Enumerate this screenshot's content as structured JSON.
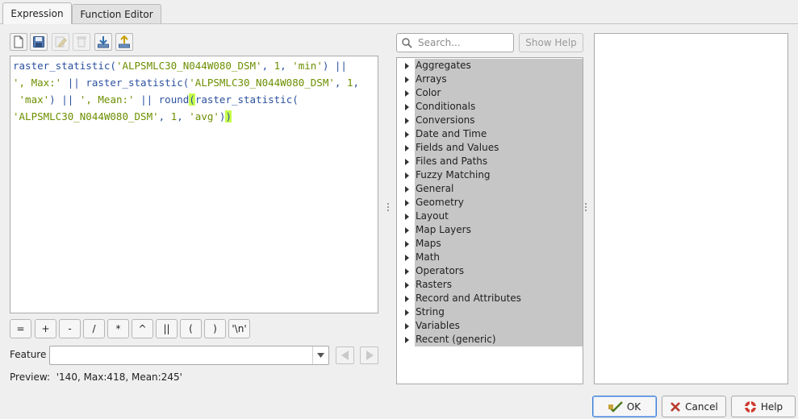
{
  "tabs": [
    {
      "label": "Expression",
      "active": true
    },
    {
      "label": "Function Editor",
      "active": false
    }
  ],
  "toolbar": {
    "icons": [
      "new-file-icon",
      "save-icon",
      "edit-icon",
      "delete-icon",
      "import-icon",
      "export-icon"
    ]
  },
  "editor": {
    "line1": {
      "fn": "raster_statistic(",
      "s1": "'ALPSMLC30_N044W080_DSM'",
      "c1": ", ",
      "n1": "1",
      "c2": ", ",
      "s2": "'min'",
      "op": ") ||"
    },
    "line2": {
      "s1": "', Max:'",
      "op1": " || ",
      "fn": "raster_statistic(",
      "s2": "'ALPSMLC30_N044W080_DSM'",
      "c1": ", ",
      "n1": "1",
      "c2": ","
    },
    "line3": {
      "pre": " ",
      "s1": "'max'",
      "op1": ") || ",
      "s2": "', Mean:'",
      "op2": " || ",
      "fn1": "round",
      "paren": "(",
      "fn2": "raster_statistic("
    },
    "line4": {
      "s1": "'ALPSMLC30_N044W080_DSM'",
      "c1": ", ",
      "n1": "1",
      "c2": ", ",
      "s2": "'avg'",
      "close1": ")",
      "close2": ")"
    }
  },
  "operators": [
    "=",
    "+",
    "-",
    "/",
    "*",
    "^",
    "||",
    "(",
    ")",
    "'\\n'"
  ],
  "feature": {
    "label": "Feature",
    "value": ""
  },
  "preview": {
    "label": "Preview:",
    "value": "'140, Max:418, Mean:245'"
  },
  "search": {
    "placeholder": "Search..."
  },
  "show_help_label": "Show Help",
  "tree": [
    "Aggregates",
    "Arrays",
    "Color",
    "Conditionals",
    "Conversions",
    "Date and Time",
    "Fields and Values",
    "Files and Paths",
    "Fuzzy Matching",
    "General",
    "Geometry",
    "Layout",
    "Map Layers",
    "Maps",
    "Math",
    "Operators",
    "Rasters",
    "Record and Attributes",
    "String",
    "Variables",
    "Recent (generic)"
  ],
  "buttons": {
    "ok": "OK",
    "cancel": "Cancel",
    "help": "Help"
  },
  "colors": {
    "function": "#2b51a0",
    "string": "#6c8f00",
    "match_highlight": "#c7ff4a",
    "selection": "#c6c6c6"
  }
}
